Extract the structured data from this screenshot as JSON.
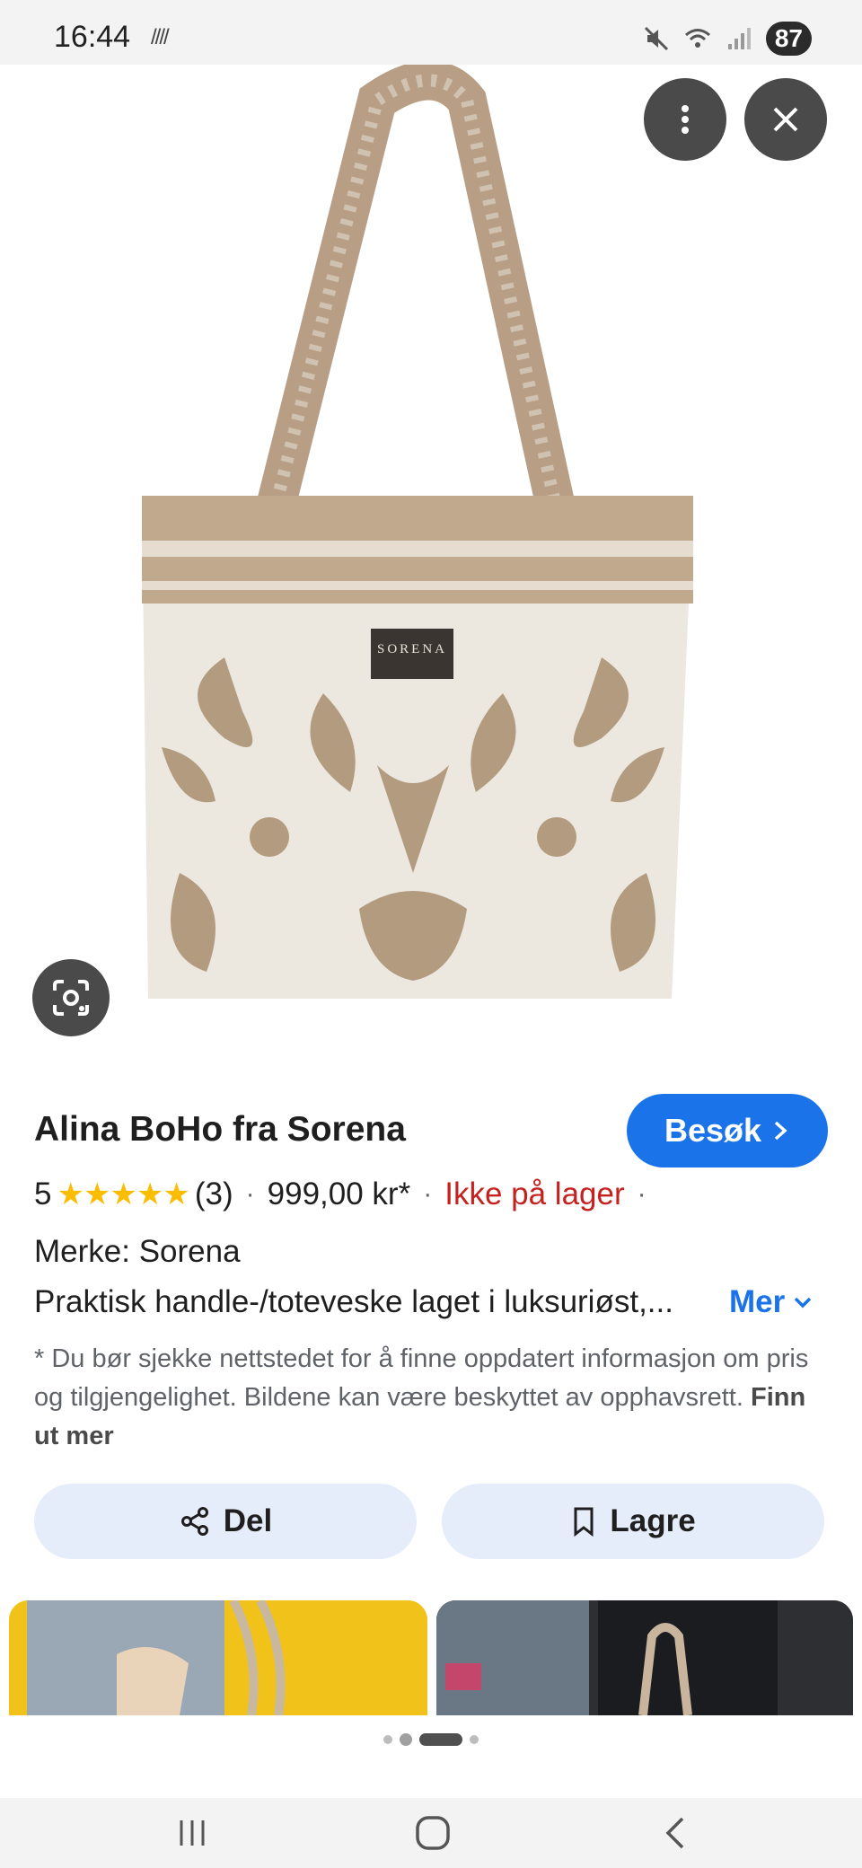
{
  "status_bar": {
    "time": "16:44",
    "extra": "////",
    "battery": "87",
    "icons": [
      "mute-icon",
      "wifi-icon",
      "signal-icon"
    ]
  },
  "image_viewer": {
    "product_image": "tote-bag-image",
    "bag_label": "SORENA",
    "icons": [
      "more-vert-icon",
      "close-icon",
      "lens-icon"
    ]
  },
  "product": {
    "title": "Alina BoHo fra Sorena",
    "visit_label": "Besøk",
    "rating": "5",
    "stars": "★★★★★",
    "review_count": "(3)",
    "price": "999,00 kr*",
    "stock": "Ikke på lager",
    "brand": "Merke: Sorena",
    "description": "Praktisk handle-/toteveske laget i luksuriøst,...",
    "more_label": "Mer",
    "disclaimer": "* Du bør sjekke nettstedet for å finne oppdatert informasjon om pris og tilgjengelighet. Bildene kan være beskyttet av opphavsrett.",
    "learn_more": "Finn ut mer"
  },
  "actions": {
    "share_label": "Del",
    "save_label": "Lagre"
  },
  "colors": {
    "accent": "#1a73e8",
    "stock_red": "#c5221f",
    "star": "#fbbc04",
    "action_bg": "#e6edfa"
  },
  "nav": [
    "recent-apps-icon",
    "home-icon",
    "back-icon"
  ]
}
